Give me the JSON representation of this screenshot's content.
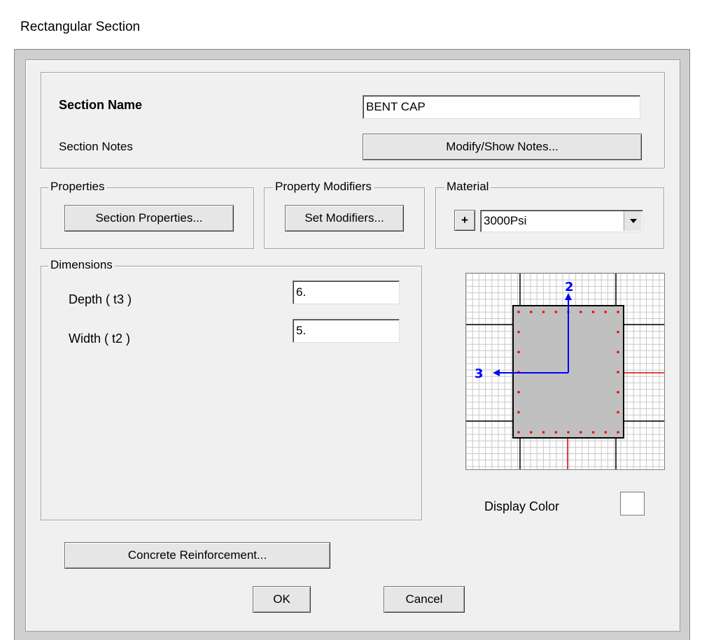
{
  "window": {
    "title": "Rectangular Section"
  },
  "section": {
    "name_label": "Section Name",
    "name_value": "BENT CAP",
    "notes_label": "Section Notes",
    "notes_button": "Modify/Show Notes..."
  },
  "properties": {
    "legend": "Properties",
    "button": "Section Properties..."
  },
  "modifiers": {
    "legend": "Property Modifiers",
    "button": "Set Modifiers..."
  },
  "material": {
    "legend": "Material",
    "add_button": "+",
    "selected": "3000Psi"
  },
  "dimensions": {
    "legend": "Dimensions",
    "depth_label": "Depth  ( t3 )",
    "depth_value": "6.",
    "width_label": "Width  ( t2 )",
    "width_value": "5."
  },
  "preview": {
    "axis2_label": "2",
    "axis3_label": "3"
  },
  "display_color": {
    "label": "Display Color",
    "color": "#ffffff"
  },
  "buttons": {
    "reinforcement": "Concrete Reinforcement...",
    "ok": "OK",
    "cancel": "Cancel"
  },
  "colors": {
    "axis_blue": "#0000ff",
    "axis_red": "#e00000",
    "section_fill": "#c0c0c0",
    "rebar": "#ff0000"
  }
}
